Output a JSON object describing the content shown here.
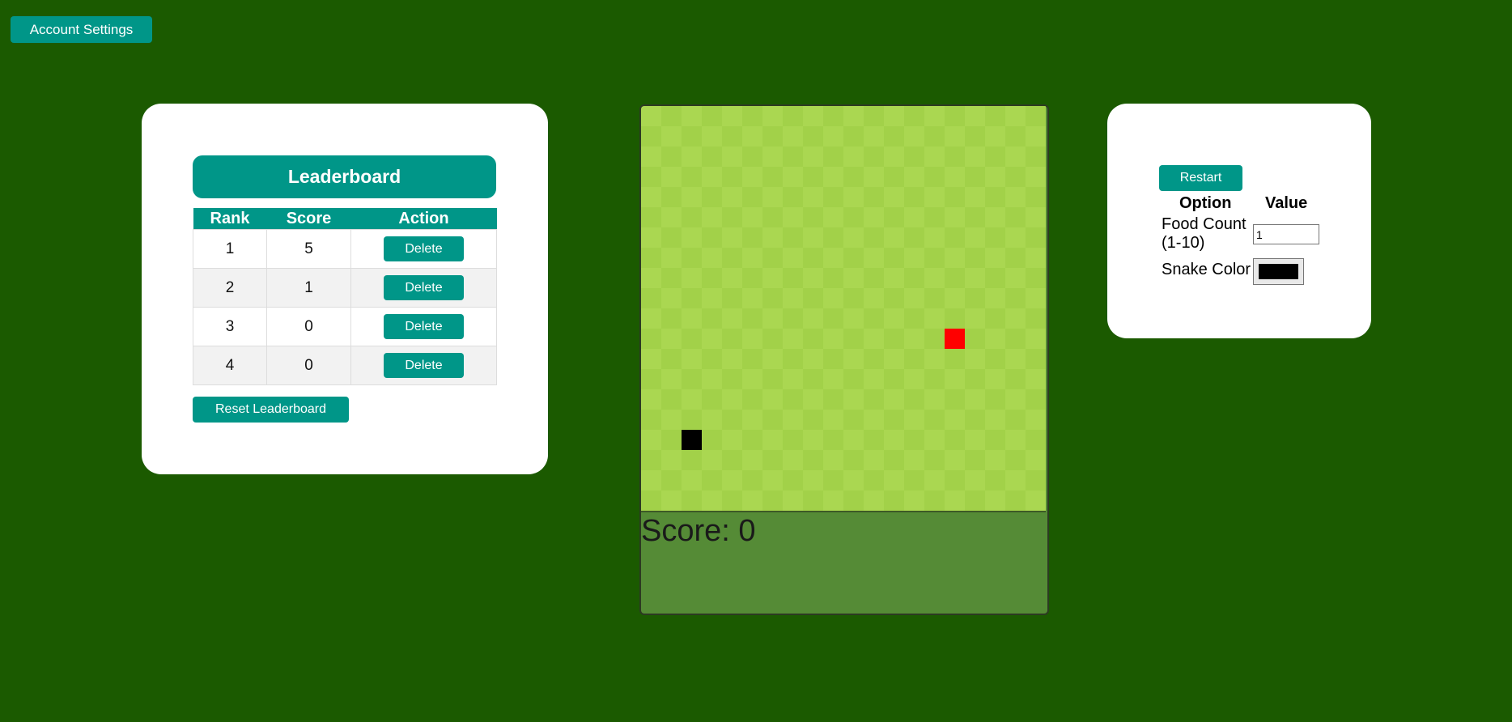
{
  "header": {
    "account_settings_label": "Account Settings"
  },
  "leaderboard": {
    "title": "Leaderboard",
    "columns": [
      "Rank",
      "Score",
      "Action"
    ],
    "rows": [
      {
        "rank": "1",
        "score": "5",
        "action_label": "Delete"
      },
      {
        "rank": "2",
        "score": "1",
        "action_label": "Delete"
      },
      {
        "rank": "3",
        "score": "0",
        "action_label": "Delete"
      },
      {
        "rank": "4",
        "score": "0",
        "action_label": "Delete"
      }
    ],
    "reset_label": "Reset Leaderboard"
  },
  "game": {
    "score_text": "Score: 0",
    "grid_cells": 20,
    "food_cell": [
      15,
      11
    ],
    "snake_cells": [
      [
        2,
        16
      ]
    ],
    "colors": {
      "board_light": "#aad751",
      "board_dark": "#a2d149",
      "food": "#ff0000",
      "snake": "#000000",
      "score_area": "#558b36"
    }
  },
  "options": {
    "restart_label": "Restart",
    "header_option": "Option",
    "header_value": "Value",
    "food_count_label": "Food Count (1-10)",
    "food_count_value": "1",
    "snake_color_label": "Snake Color",
    "snake_color_value": "#000000"
  },
  "colors": {
    "page_bg": "#1b5a00",
    "accent": "#009688",
    "card_bg": "#ffffff"
  }
}
